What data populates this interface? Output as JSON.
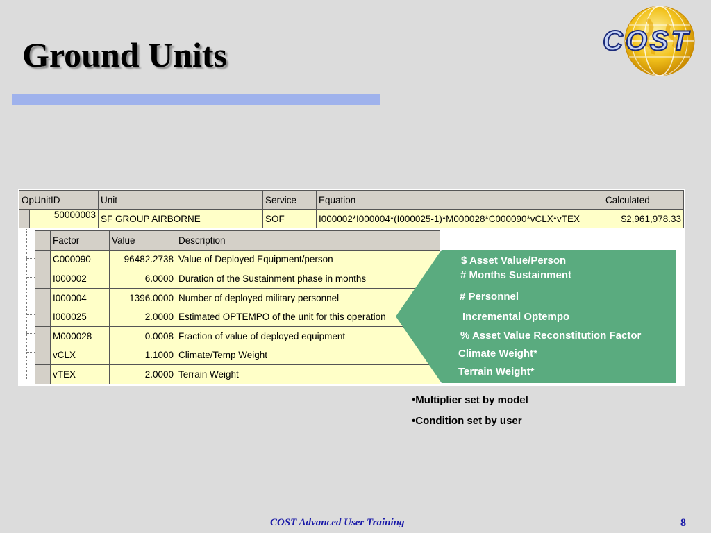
{
  "slide": {
    "title": "Ground Units",
    "logo_text": "COST",
    "footer": "COST Advanced User Training",
    "page_number": "8"
  },
  "main_table": {
    "headers": [
      "OpUnitID",
      "Unit",
      "Service",
      "Equation",
      "Calculated"
    ],
    "row": {
      "opunitid": "50000003",
      "unit": "SF GROUP AIRBORNE",
      "service": "SOF",
      "equation": "I000002*I000004*(I000025-1)*M000028*C000090*vCLX*vTEX",
      "calculated": "$2,961,978.33"
    }
  },
  "factor_table": {
    "headers": [
      "Factor",
      "Value",
      "Description"
    ],
    "rows": [
      {
        "factor": "C000090",
        "value": "96482.2738",
        "description": "Value of Deployed Equipment/person"
      },
      {
        "factor": "I000002",
        "value": "6.0000",
        "description": "Duration of the Sustainment phase in months"
      },
      {
        "factor": "I000004",
        "value": "1396.0000",
        "description": "Number of deployed military personnel"
      },
      {
        "factor": "I000025",
        "value": "2.0000",
        "description": "Estimated OPTEMPO of the unit for this operation"
      },
      {
        "factor": "M000028",
        "value": "0.0008",
        "description": "Fraction of value of deployed equipment"
      },
      {
        "factor": "vCLX",
        "value": "1.1000",
        "description": "Climate/Temp Weight"
      },
      {
        "factor": "vTEX",
        "value": "2.0000",
        "description": "Terrain Weight"
      }
    ]
  },
  "callout": {
    "color": "#5aab7f",
    "items": [
      "$ Asset Value/Person",
      "# Months Sustainment",
      "# Personnel",
      "Incremental Optempo",
      "% Asset Value Reconstitution Factor",
      "Climate Weight*",
      "Terrain Weight*"
    ]
  },
  "notes": [
    "•Multiplier set by model",
    "•Condition set by user"
  ]
}
